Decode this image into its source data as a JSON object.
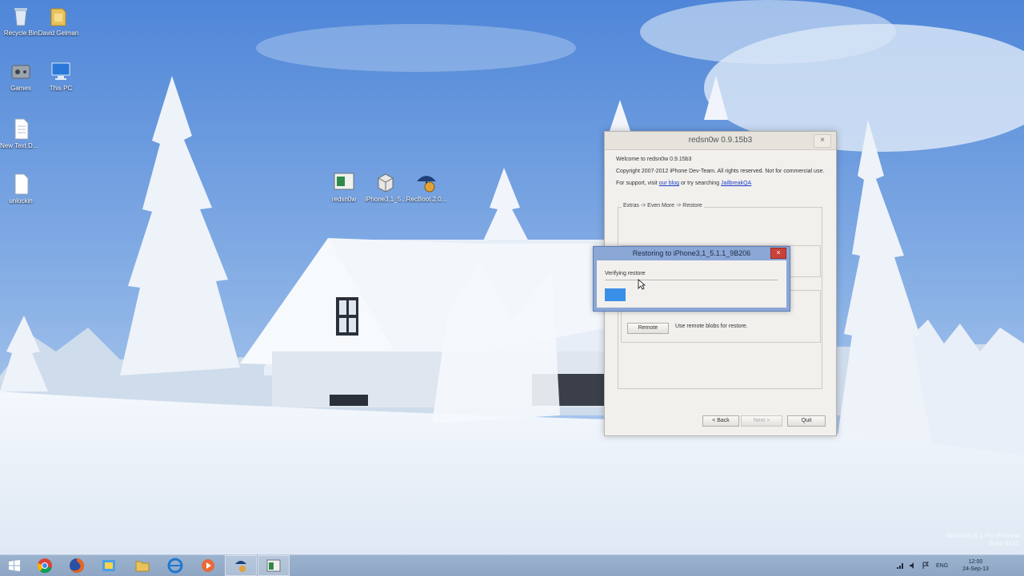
{
  "desktop": {
    "icons": [
      {
        "label": "Recycle Bin",
        "icon": "recycle-bin-icon"
      },
      {
        "label": "David Gelman",
        "icon": "folder-icon"
      },
      {
        "label": "Games",
        "icon": "games-icon"
      },
      {
        "label": "This PC",
        "icon": "computer-icon"
      },
      {
        "label": "New Text Document",
        "icon": "text-document-icon"
      },
      {
        "label": "unlockin",
        "icon": "document-icon"
      },
      {
        "label": "redsn0w",
        "icon": "application-icon"
      },
      {
        "label": "iPhone3,1_5...",
        "icon": "firmware-file-icon"
      },
      {
        "label": "RecBoot 2.0...",
        "icon": "recboot-icon"
      }
    ]
  },
  "main_window": {
    "title": "redsn0w 0.9.15b3",
    "welcome": "Welcome to redsn0w 0.9.15b3",
    "copyright": "Copyright 2007-2012 iPhone Dev-Team. All rights reserved. Not for commercial use.",
    "support_prefix": "For support, visit",
    "blog_link": "our blog",
    "support_middle": "or try searching",
    "search_link": "JailbreakQA",
    "breadcrumb": "Extras -> Even More -> Restore",
    "remote_button": "Remote",
    "remote_desc": "Use remote blobs for restore.",
    "back_button": "< Back",
    "next_button": "Next >",
    "quit_button": "Quit",
    "close_glyph": "×"
  },
  "progress_dialog": {
    "title": "Restoring to iPhone3,1_5.1.1_9B206",
    "status": "Verifying restore",
    "progress": 0.12,
    "close_glyph": "×"
  },
  "taskbar": {
    "apps": [
      {
        "icon": "windows-start-icon"
      },
      {
        "icon": "chrome-icon"
      },
      {
        "icon": "firefox-icon"
      },
      {
        "icon": "mail-icon"
      },
      {
        "icon": "file-explorer-icon"
      },
      {
        "icon": "internet-explorer-icon"
      },
      {
        "icon": "media-player-icon"
      },
      {
        "icon": "recboot-icon"
      },
      {
        "icon": "redsn0w-icon"
      }
    ],
    "tray_language": "ENG",
    "clock_time": "12:00",
    "clock_date": "24-Sep-13"
  },
  "watermark": {
    "line1": "Windows 8.1 Pro Preview",
    "line2": "Build 9431"
  },
  "colors": {
    "progress_fill": "#3a8fe8",
    "dialog_frame": "#8ba7d6",
    "close_red": "#c9423a",
    "link": "#1a3fc7"
  }
}
